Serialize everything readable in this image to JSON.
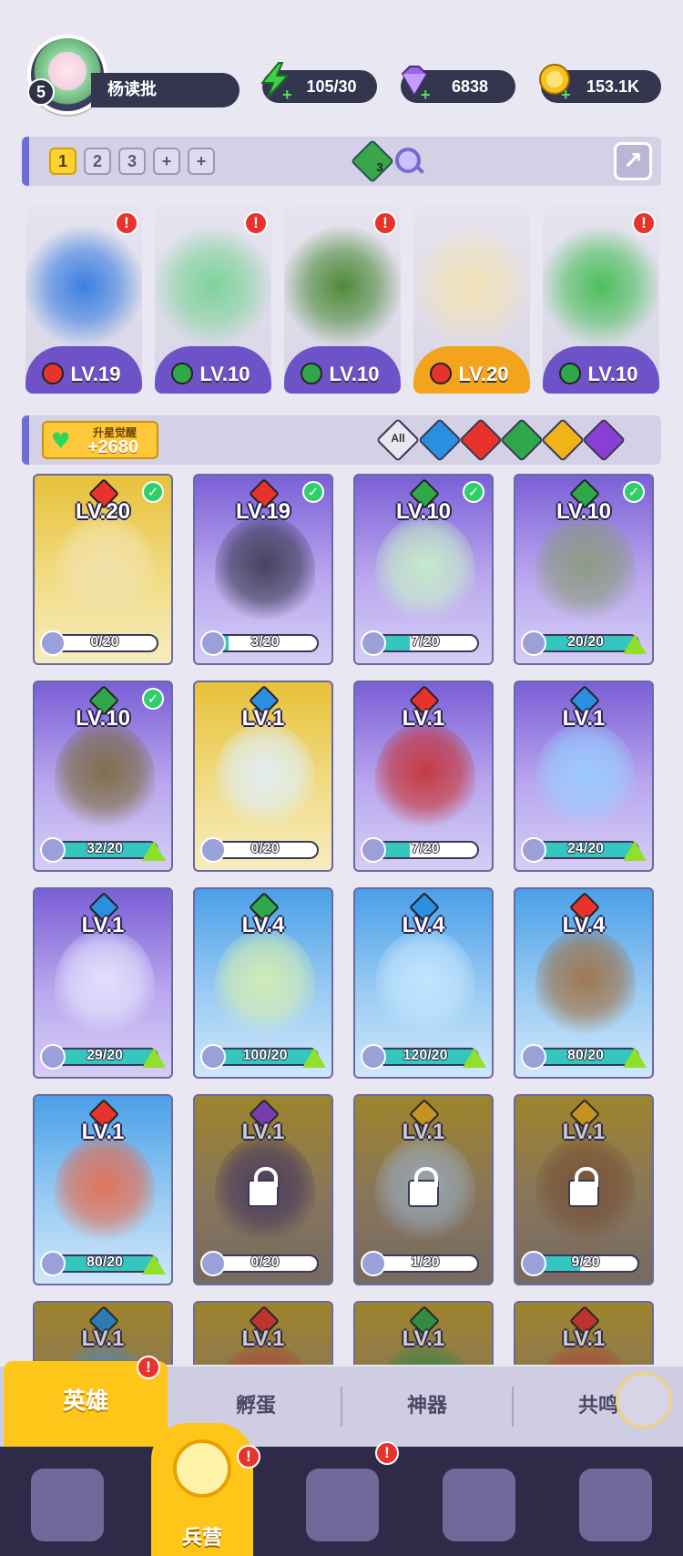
{
  "player": {
    "level": "5",
    "name": "杨读批"
  },
  "resources": [
    {
      "name": "energy",
      "icon": "lightning-icon",
      "value": "105/30",
      "color": "#3fd04a"
    },
    {
      "name": "gems",
      "icon": "diamond-icon",
      "value": "6838",
      "color": "#9b63e8"
    },
    {
      "name": "gold",
      "icon": "coin-icon",
      "value": "153.1K",
      "color": "#f5c320"
    }
  ],
  "team": {
    "slots": [
      "1",
      "2",
      "3",
      "+",
      "+"
    ],
    "active_slot": "1",
    "gem_count": "3"
  },
  "squad": [
    {
      "level": "LV.19",
      "element": "fire",
      "alert": "!"
    },
    {
      "level": "LV.10",
      "element": "wind",
      "alert": "!"
    },
    {
      "level": "LV.10",
      "element": "wind",
      "alert": "!"
    },
    {
      "level": "LV.20",
      "element": "fire",
      "alert": ""
    },
    {
      "level": "LV.10",
      "element": "wind",
      "alert": "!"
    }
  ],
  "awaken": {
    "label": "升星觉醒",
    "value": "+2680"
  },
  "filters": {
    "all_label": "All",
    "elements": [
      "water",
      "fire",
      "wind",
      "light",
      "dark"
    ]
  },
  "element_colors": {
    "fire": "#e8332d",
    "wind": "#2fa84a",
    "water": "#2b8fe0",
    "light": "#f2b21a",
    "dark": "#8a3fd4"
  },
  "heroes": [
    {
      "level": "LV.20",
      "element": "fire",
      "progress": "0/20",
      "owned": true,
      "in_team": true,
      "can_upgrade": false,
      "bg": "gold"
    },
    {
      "level": "LV.19",
      "element": "fire",
      "progress": "3/20",
      "owned": true,
      "in_team": true,
      "can_upgrade": false,
      "bg": "purple"
    },
    {
      "level": "LV.10",
      "element": "wind",
      "progress": "7/20",
      "owned": true,
      "in_team": true,
      "can_upgrade": false,
      "bg": "purple"
    },
    {
      "level": "LV.10",
      "element": "wind",
      "progress": "20/20",
      "owned": true,
      "in_team": true,
      "can_upgrade": true,
      "bg": "purple"
    },
    {
      "level": "LV.10",
      "element": "wind",
      "progress": "32/20",
      "owned": true,
      "in_team": true,
      "can_upgrade": true,
      "bg": "purple"
    },
    {
      "level": "LV.1",
      "element": "water",
      "progress": "0/20",
      "owned": true,
      "in_team": false,
      "can_upgrade": false,
      "bg": "gold"
    },
    {
      "level": "LV.1",
      "element": "fire",
      "progress": "7/20",
      "owned": true,
      "in_team": false,
      "can_upgrade": false,
      "bg": "purple"
    },
    {
      "level": "LV.1",
      "element": "water",
      "progress": "24/20",
      "owned": true,
      "in_team": false,
      "can_upgrade": true,
      "bg": "purple"
    },
    {
      "level": "LV.1",
      "element": "water",
      "progress": "29/20",
      "owned": true,
      "in_team": false,
      "can_upgrade": true,
      "bg": "purple"
    },
    {
      "level": "LV.4",
      "element": "wind",
      "progress": "100/20",
      "owned": true,
      "in_team": false,
      "can_upgrade": true,
      "bg": "blue"
    },
    {
      "level": "LV.4",
      "element": "water",
      "progress": "120/20",
      "owned": true,
      "in_team": false,
      "can_upgrade": true,
      "bg": "blue"
    },
    {
      "level": "LV.4",
      "element": "fire",
      "progress": "80/20",
      "owned": true,
      "in_team": false,
      "can_upgrade": true,
      "bg": "blue"
    },
    {
      "level": "LV.1",
      "element": "fire",
      "progress": "80/20",
      "owned": true,
      "in_team": false,
      "can_upgrade": true,
      "bg": "blue"
    },
    {
      "level": "LV.1",
      "element": "dark",
      "progress": "0/20",
      "owned": false,
      "in_team": false,
      "can_upgrade": false,
      "bg": "locked"
    },
    {
      "level": "LV.1",
      "element": "light",
      "progress": "1/20",
      "owned": false,
      "in_team": false,
      "can_upgrade": false,
      "bg": "locked"
    },
    {
      "level": "LV.1",
      "element": "light",
      "progress": "9/20",
      "owned": false,
      "in_team": false,
      "can_upgrade": false,
      "bg": "locked"
    },
    {
      "level": "LV.1",
      "element": "water",
      "progress": "",
      "owned": false,
      "in_team": false,
      "can_upgrade": false,
      "bg": "locked"
    },
    {
      "level": "LV.1",
      "element": "fire",
      "progress": "",
      "owned": false,
      "in_team": false,
      "can_upgrade": false,
      "bg": "locked"
    },
    {
      "level": "LV.1",
      "element": "wind",
      "progress": "",
      "owned": false,
      "in_team": false,
      "can_upgrade": false,
      "bg": "locked"
    },
    {
      "level": "LV.1",
      "element": "fire",
      "progress": "",
      "owned": false,
      "in_team": false,
      "can_upgrade": false,
      "bg": "locked"
    }
  ],
  "subtabs": [
    {
      "label": "英雄",
      "active": true,
      "alert": "!"
    },
    {
      "label": "孵蛋",
      "active": false,
      "alert": ""
    },
    {
      "label": "神器",
      "active": false,
      "alert": ""
    },
    {
      "label": "共鸣",
      "active": false,
      "alert": ""
    }
  ],
  "bottom_nav": [
    {
      "icon": "cards-icon",
      "label": "",
      "active": false,
      "alert": ""
    },
    {
      "icon": "barracks-icon",
      "label": "兵营",
      "active": true,
      "alert": "!"
    },
    {
      "icon": "book-icon",
      "label": "",
      "active": false,
      "alert": "!"
    },
    {
      "icon": "castle-icon",
      "label": "",
      "active": false,
      "alert": ""
    },
    {
      "icon": "mushroom-icon",
      "label": "",
      "active": false,
      "alert": ""
    }
  ]
}
